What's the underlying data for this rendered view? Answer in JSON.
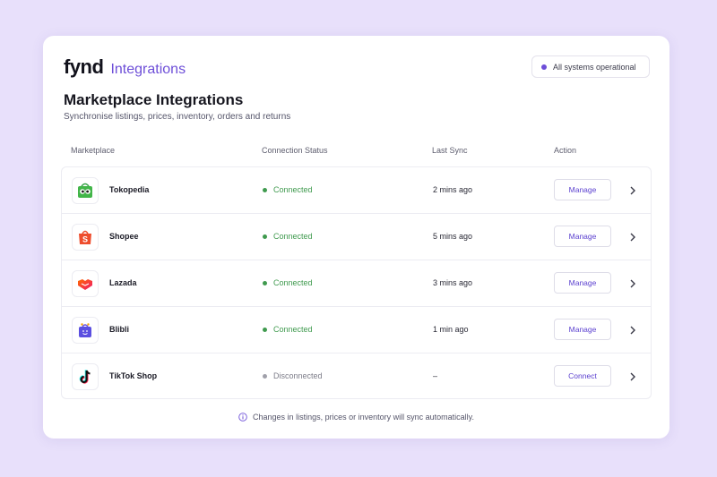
{
  "brand": {
    "logo": "fynd",
    "product": "Integrations"
  },
  "system_status": {
    "label": "All systems operational",
    "color": "#6d4ed8"
  },
  "page": {
    "title": "Marketplace Integrations",
    "subtitle": "Synchronise listings, prices, inventory, orders and returns"
  },
  "table": {
    "headers": [
      "Marketplace",
      "Connection Status",
      "Last Sync",
      "Action"
    ],
    "rows": [
      {
        "name": "Tokopedia",
        "icon": "tokopedia-logo-icon",
        "status": "Connected",
        "last_sync": "2 mins ago",
        "action": "Manage"
      },
      {
        "name": "Shopee",
        "icon": "shopee-logo-icon",
        "status": "Connected",
        "last_sync": "5 mins ago",
        "action": "Manage"
      },
      {
        "name": "Lazada",
        "icon": "lazada-logo-icon",
        "status": "Connected",
        "last_sync": "3 mins ago",
        "action": "Manage"
      },
      {
        "name": "Blibli",
        "icon": "blibli-logo-icon",
        "status": "Connected",
        "last_sync": "1 min ago",
        "action": "Manage"
      },
      {
        "name": "TikTok Shop",
        "icon": "tiktok-logo-icon",
        "status": "Disconnected",
        "last_sync": "–",
        "action": "Connect"
      }
    ]
  },
  "footnote": "Changes in listings, prices or inventory will sync automatically.",
  "colors": {
    "accent": "#6d4ed8",
    "connected": "#3f9a4e",
    "disconnected": "#a0a0aa",
    "background": "#e8e0fb"
  }
}
